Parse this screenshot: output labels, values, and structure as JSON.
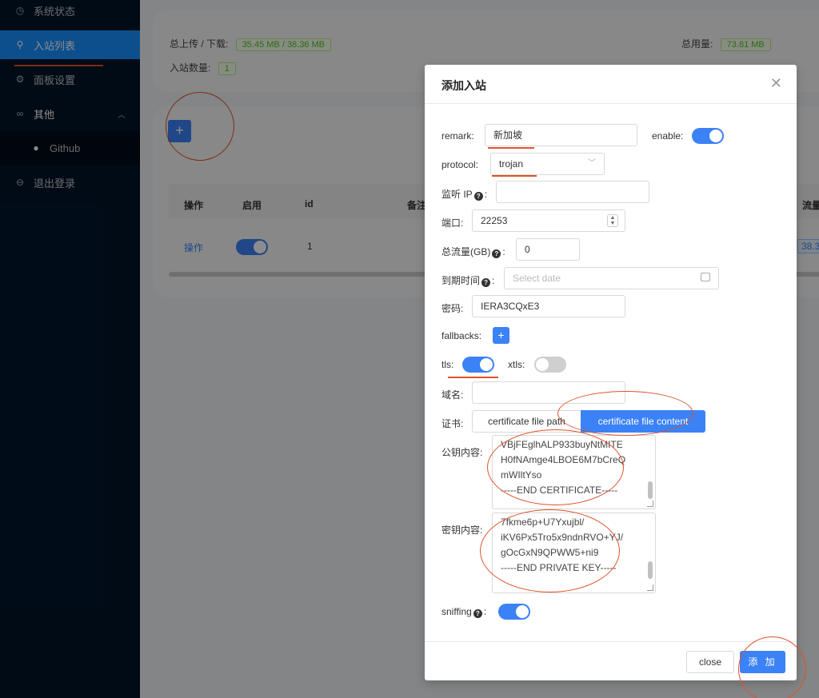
{
  "sidebar": {
    "items": [
      {
        "label": "系统状态",
        "icon": "dashboard-icon"
      },
      {
        "label": "入站列表",
        "icon": "user-icon"
      },
      {
        "label": "面板设置",
        "icon": "gear-icon"
      },
      {
        "label": "其他",
        "icon": "link-icon"
      },
      {
        "label": "Github",
        "icon": "github-icon"
      },
      {
        "label": "退出登录",
        "icon": "logout-icon"
      }
    ]
  },
  "stats": {
    "traffic_label": "总上传 / 下载:",
    "traffic_value": "35.45 MB / 38.36 MB",
    "usage_label": "总用量:",
    "usage_value": "73.81 MB",
    "inbound_count_label": "入站数量:",
    "inbound_count_value": "1"
  },
  "table": {
    "add_label": "+",
    "headers": [
      "操作",
      "启用",
      "id",
      "备注",
      "流量"
    ],
    "rows": [
      {
        "action": "操作",
        "id": "1",
        "traffic": "38.3"
      }
    ]
  },
  "modal": {
    "title": "添加入站",
    "close_icon": "close-icon",
    "fields": {
      "remark_label": "remark:",
      "remark_value": "新加坡",
      "enable_label": "enable:",
      "protocol_label": "protocol:",
      "protocol_value": "trojan",
      "listen_ip_label": "监听 IP",
      "listen_ip_value": "",
      "port_label": "端口:",
      "port_value": "22253",
      "total_traffic_label": "总流量(GB)",
      "total_traffic_value": "0",
      "expiry_label": "到期时间",
      "expiry_placeholder": "Select date",
      "password_label": "密码:",
      "password_value": "IERA3CQxE3",
      "fallbacks_label": "fallbacks:",
      "tls_label": "tls:",
      "xtls_label": "xtls:",
      "domain_label": "域名:",
      "domain_value": "",
      "cert_label": "证书:",
      "cert_path_option": "certificate file path",
      "cert_content_option": "certificate file content",
      "public_key_label": "公钥内容:",
      "public_key_lines": [
        "VBjFEglhALP933buyNtMITE",
        "H0fNAmge4LBOE6M7bCreQ",
        "mWIltYso",
        "-----END CERTIFICATE-----"
      ],
      "private_key_label": "密钥内容:",
      "private_key_lines": [
        "7fkme6p+U7Yxujbl/",
        "iKV6Px5Tro5x9ndnRVO+YJ/",
        "gOcGxN9QPWW5+ni9",
        "-----END PRIVATE KEY-----"
      ],
      "sniffing_label": "sniffing"
    },
    "toggles": {
      "enable": true,
      "tls": true,
      "xtls": false,
      "sniffing": true
    },
    "footer": {
      "close_label": "close",
      "add_label": "添 加"
    }
  },
  "colors": {
    "accent": "#3b82f6",
    "sidebar_bg": "#001529",
    "annotation": "#e0522a"
  }
}
